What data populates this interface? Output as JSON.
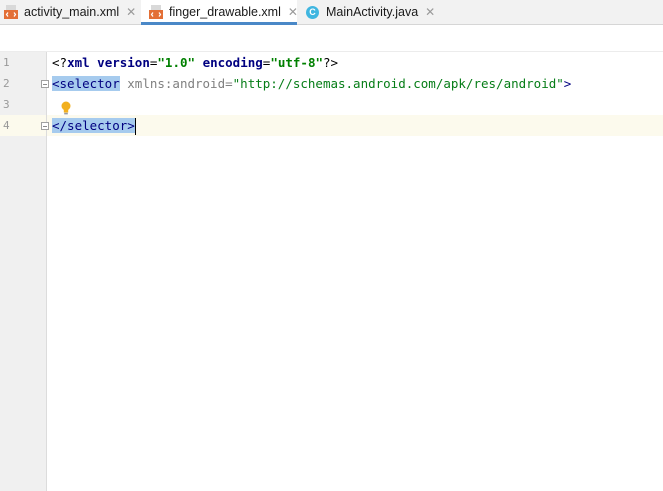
{
  "tabs": [
    {
      "label": "activity_main.xml",
      "icon": "xml-file-icon",
      "active": false
    },
    {
      "label": "finger_drawable.xml",
      "icon": "xml-file-icon",
      "active": true
    },
    {
      "label": "MainActivity.java",
      "icon": "java-class-icon",
      "active": false
    }
  ],
  "close_glyph": "✕",
  "java_icon_letter": "C",
  "editor": {
    "line_numbers": [
      "1",
      "2",
      "3",
      "4"
    ],
    "current_line": 4,
    "lines": [
      {
        "p1": "<?",
        "kw": "xml",
        "s1": " ",
        "a1": "version",
        "eq1": "=",
        "v1": "\"1.0\"",
        "s2": " ",
        "a2": "encoding",
        "eq2": "=",
        "v2": "\"utf-8\"",
        "p2": "?>"
      },
      {
        "tag_open": "<selector",
        "space": " ",
        "attr": "xmlns:android",
        "eq": "=",
        "value": "\"http://schemas.android.com/apk/res/android\"",
        "close": ">"
      },
      {
        "text": ""
      },
      {
        "tag_close": "</selector>"
      }
    ]
  },
  "colors": {
    "accent": "#4a88c7",
    "selection": "#a6cbee",
    "current_line": "#fcfaed",
    "tag": "#000080",
    "string": "#067d17"
  }
}
